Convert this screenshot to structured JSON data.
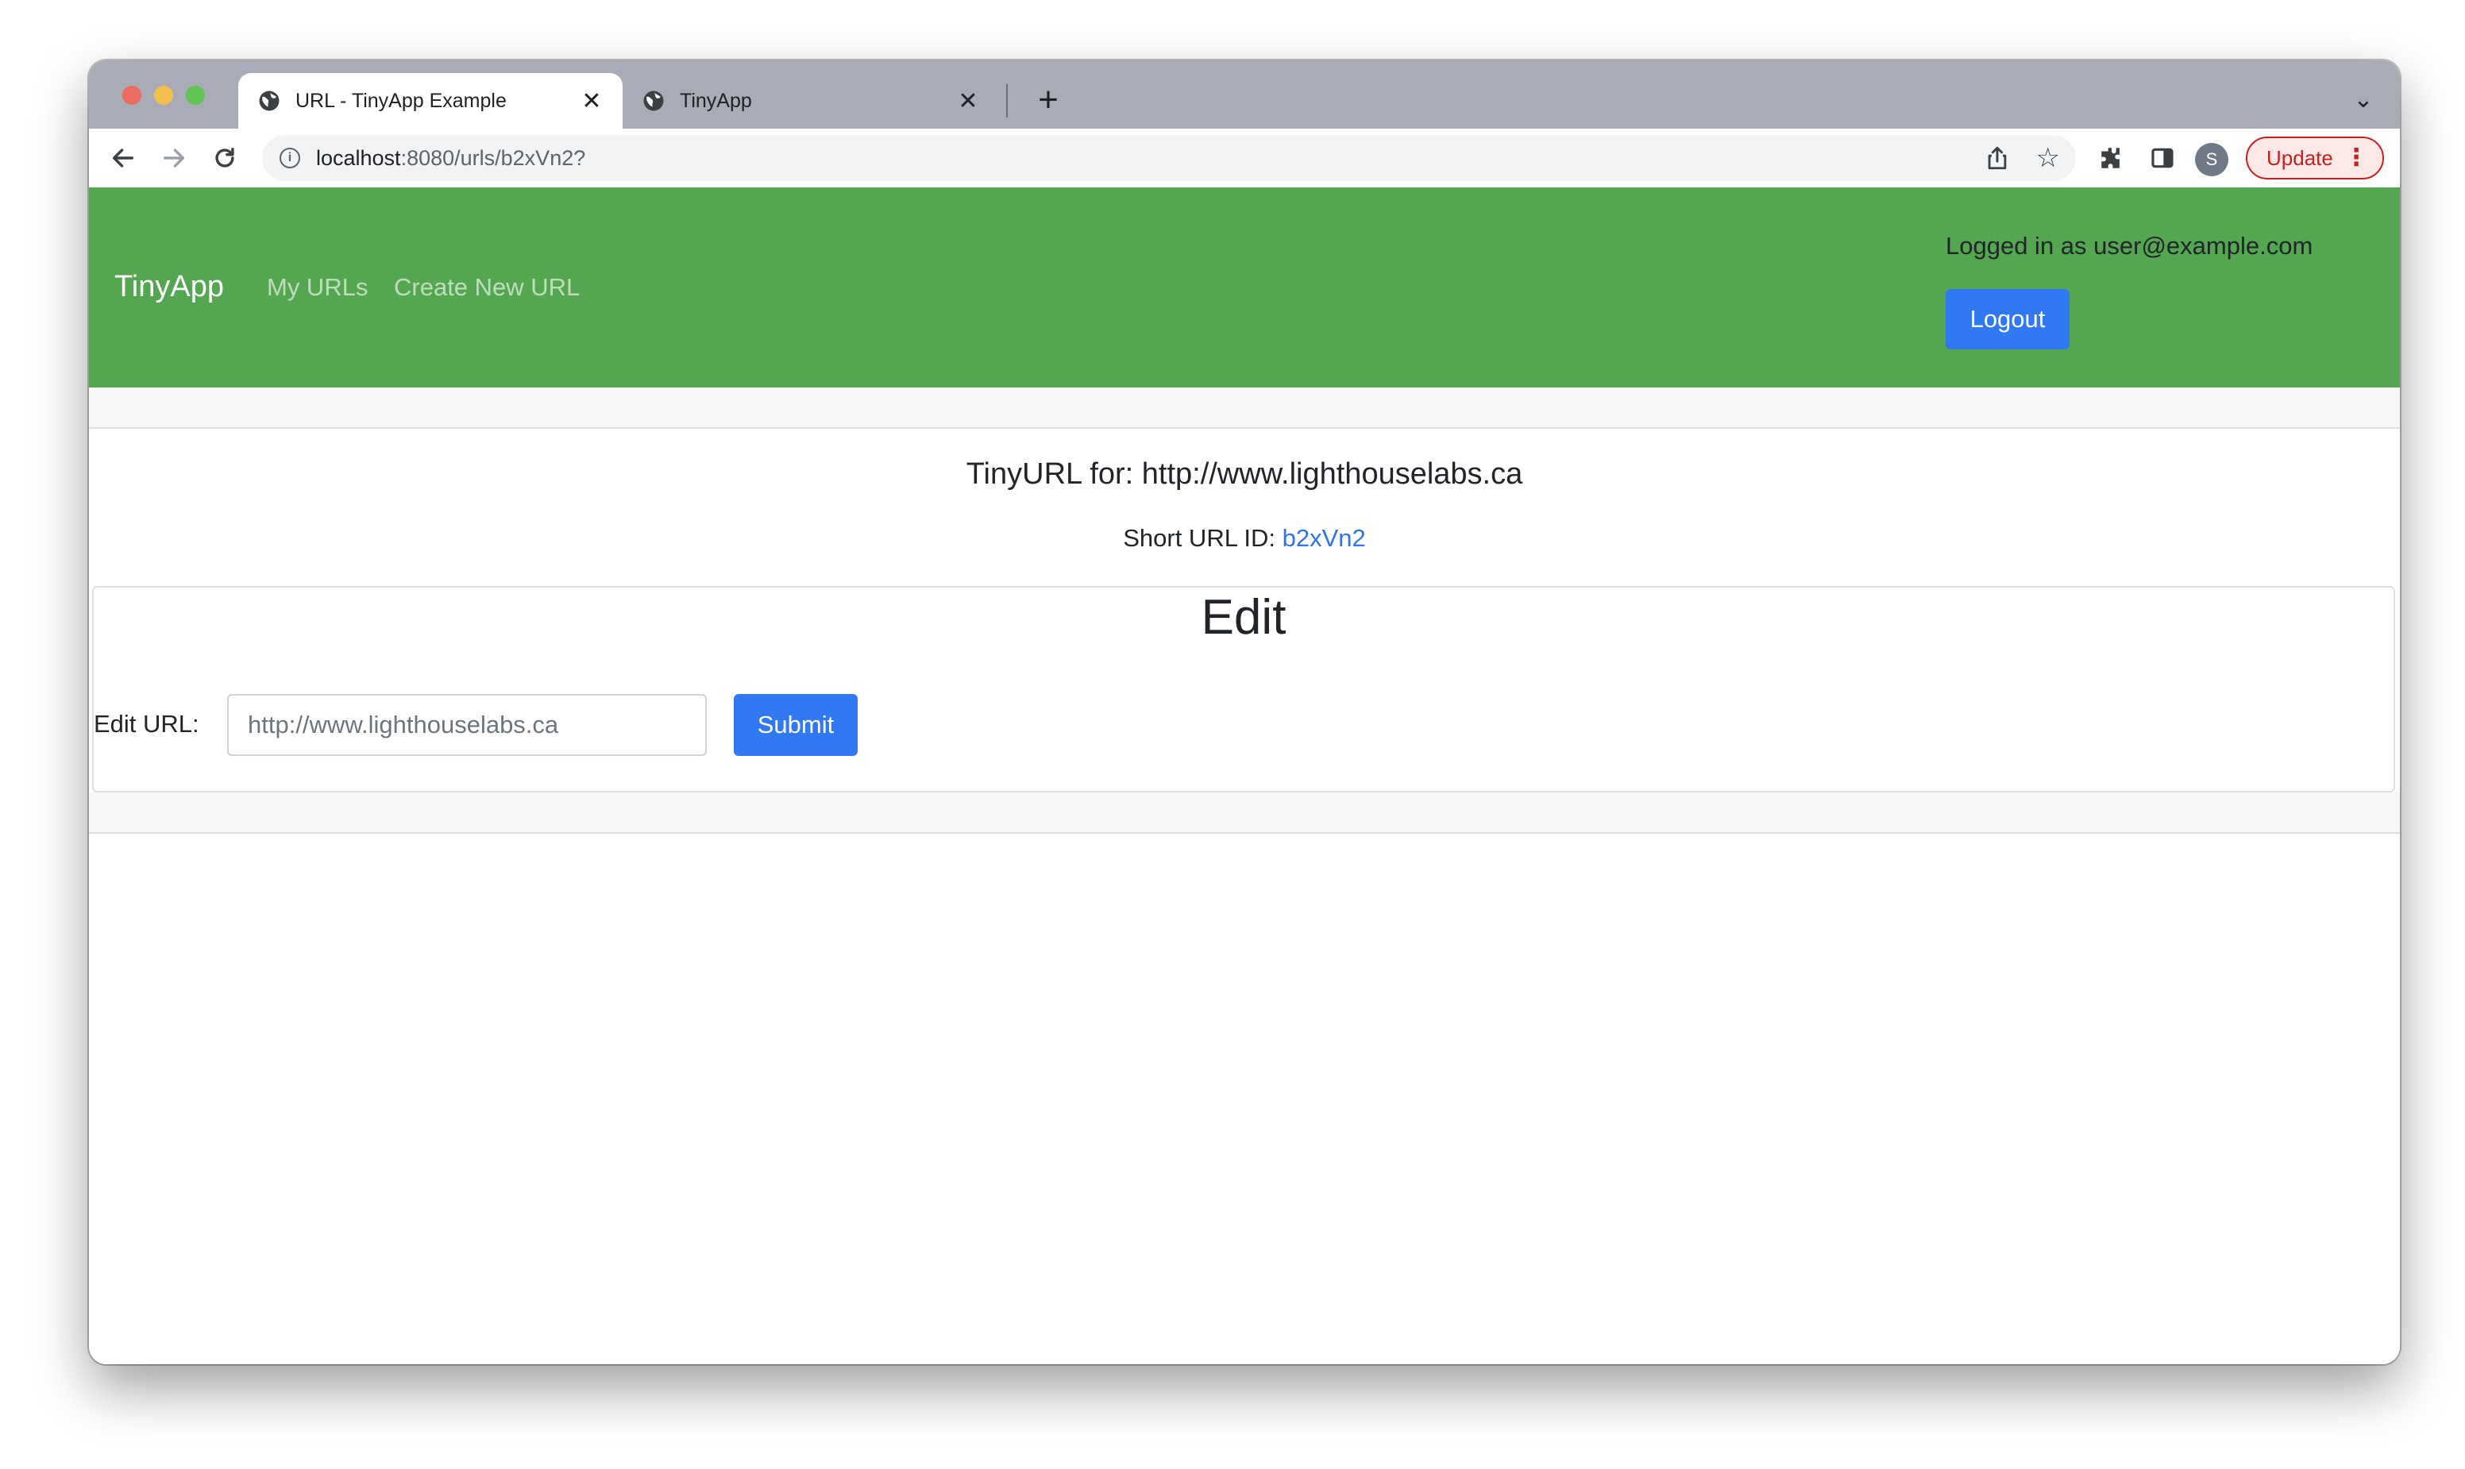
{
  "browser": {
    "tabs": [
      {
        "title": "URL - TinyApp Example",
        "active": true
      },
      {
        "title": "TinyApp",
        "active": false
      }
    ],
    "tab_close_glyph": "✕",
    "new_tab_glyph": "+",
    "tab_search_glyph": "⌄",
    "address": {
      "host": "localhost",
      "path": ":8080/urls/b2xVn2?"
    },
    "update_label": "Update",
    "avatar_letter": "S",
    "icons": [
      "globe-icon",
      "back-arrow-icon",
      "forward-arrow-icon",
      "reload-icon",
      "info-icon",
      "share-icon",
      "star-icon",
      "extensions-icon",
      "side-panel-icon",
      "kebab-menu-icon"
    ]
  },
  "navbar": {
    "brand": "TinyApp",
    "links": [
      "My URLs",
      "Create New URL"
    ],
    "login_text": "Logged in as user@example.com",
    "logout_label": "Logout",
    "color": "#54a651"
  },
  "main": {
    "title": "TinyURL for: http://www.lighthouselabs.ca",
    "short_id_label": "Short URL ID: ",
    "short_id": "b2xVn2",
    "edit": {
      "heading": "Edit",
      "label": "Edit URL:",
      "placeholder": "http://www.lighthouselabs.ca",
      "submit_label": "Submit"
    },
    "accent_color": "#3179f2"
  }
}
